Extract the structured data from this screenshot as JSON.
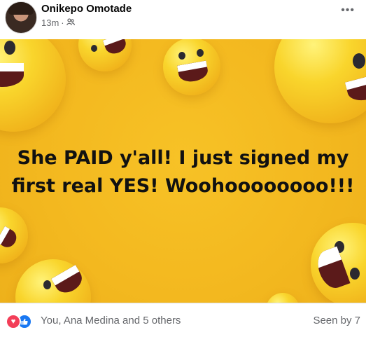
{
  "post": {
    "author": "Onikepo Omotade",
    "time": "13m",
    "separator": "·",
    "audience_icon": "friends-icon",
    "more_label": "•••",
    "text_line1": "She PAID y'all! I just signed my",
    "text_line2": "first real YES! Woohoooooooo!!!",
    "background_color": "#f3b81f"
  },
  "footer": {
    "reaction_icons": [
      "heart-icon",
      "like-icon"
    ],
    "reactions_text": "You, Ana Medina and 5 others",
    "seen_text": "Seen by 7"
  }
}
